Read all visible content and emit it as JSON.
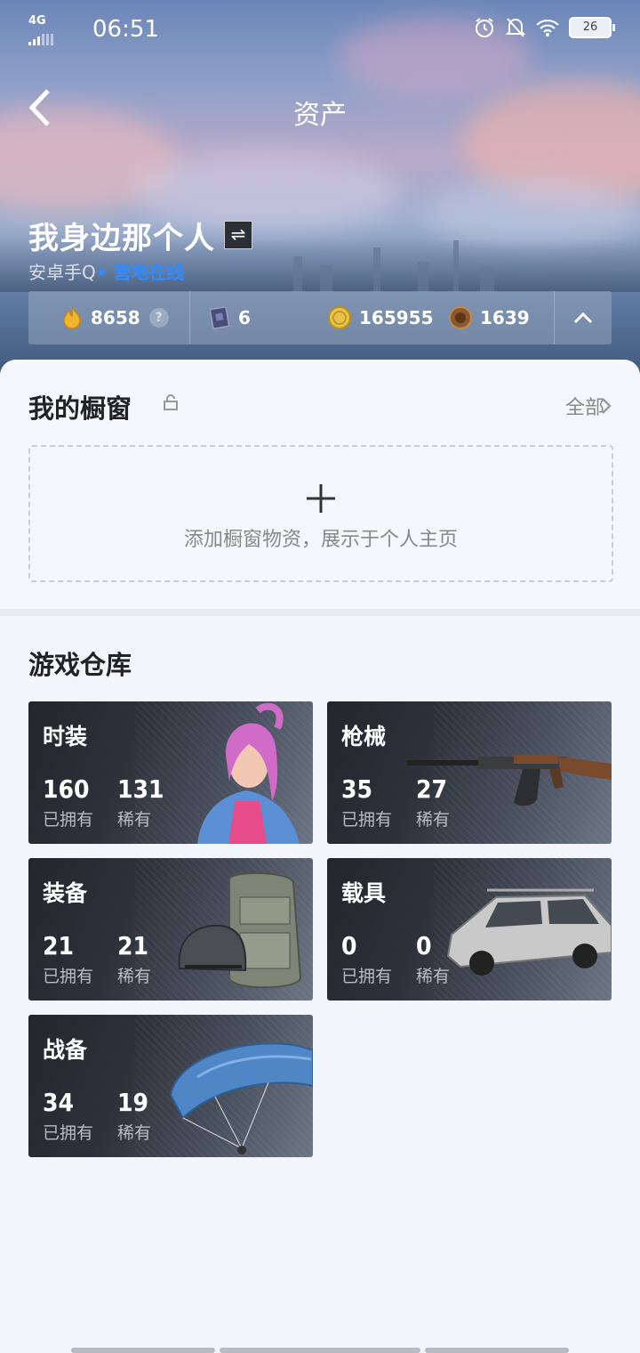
{
  "status_bar": {
    "network": "4G",
    "time": "06:51",
    "battery": "26"
  },
  "header": {
    "title": "资产",
    "username": "我身边那个人",
    "switch_label": "⇌",
    "platform": "安卓手Q",
    "online_status": "• 营地在线"
  },
  "currencies": [
    {
      "icon": "flame-coin-icon",
      "value": "8658",
      "help": "?"
    },
    {
      "icon": "card-ticket-icon",
      "value": "6"
    },
    {
      "icon": "gold-coin-icon",
      "value": "165955"
    },
    {
      "icon": "bronze-medal-icon",
      "value": "1639"
    }
  ],
  "showcase": {
    "title": "我的橱窗",
    "all_link": "全部",
    "add_text": "添加橱窗物资，展示于个人主页"
  },
  "warehouse": {
    "title": "游戏仓库",
    "owned_label": "已拥有",
    "rare_label": "稀有",
    "categories": [
      {
        "name": "时装",
        "owned": "160",
        "rare": "131",
        "art": "character-outfit-icon"
      },
      {
        "name": "枪械",
        "owned": "35",
        "rare": "27",
        "art": "rifle-icon"
      },
      {
        "name": "装备",
        "owned": "21",
        "rare": "21",
        "art": "helmet-backpack-icon"
      },
      {
        "name": "载具",
        "owned": "0",
        "rare": "0",
        "art": "car-icon"
      },
      {
        "name": "战备",
        "owned": "34",
        "rare": "19",
        "art": "parachute-icon"
      }
    ]
  },
  "colors": {
    "accent_online": "#2f8cff",
    "card_dark": "#23262d",
    "page_bg": "#f2f5fa"
  }
}
